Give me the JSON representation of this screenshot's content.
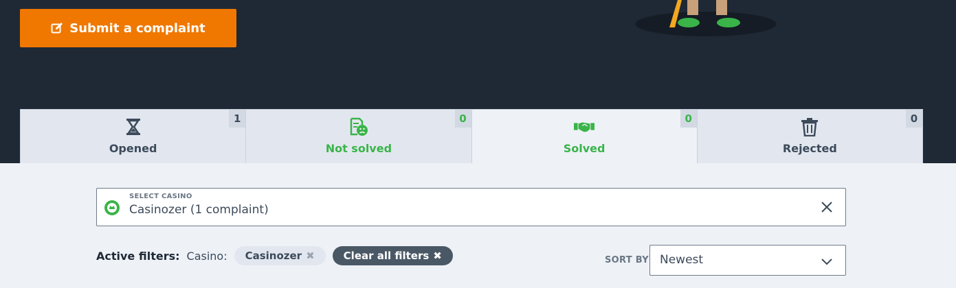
{
  "hero": {
    "submit_label": "Submit a complaint",
    "submit_icon": "edit-icon"
  },
  "tabs": [
    {
      "label": "Opened",
      "count": "1",
      "icon": "hourglass-icon",
      "color": "#3c4a5a",
      "active": false
    },
    {
      "label": "Not solved",
      "count": "0",
      "icon": "sad-document-icon",
      "color": "#3ab449",
      "active": false
    },
    {
      "label": "Solved",
      "count": "0",
      "icon": "handshake-icon",
      "color": "#3ab449",
      "active": true
    },
    {
      "label": "Rejected",
      "count": "0",
      "icon": "trash-icon",
      "color": "#3c4a5a",
      "active": false
    }
  ],
  "casino_select": {
    "label": "SELECT CASINO",
    "value": "Casinozer  (1 complaint)",
    "icon": "casino-chip-icon",
    "clear_icon": "close-icon"
  },
  "filters": {
    "label": "Active filters:",
    "casino_label": "Casino:",
    "casino_chip": "Casinozer",
    "clear_all": "Clear all filters"
  },
  "sort": {
    "label": "SORT BY",
    "value": "Newest"
  },
  "colors": {
    "hero_bg": "#1f2935",
    "accent_orange": "#f07800",
    "green": "#3ab449",
    "page_bg": "#eef2f7"
  }
}
